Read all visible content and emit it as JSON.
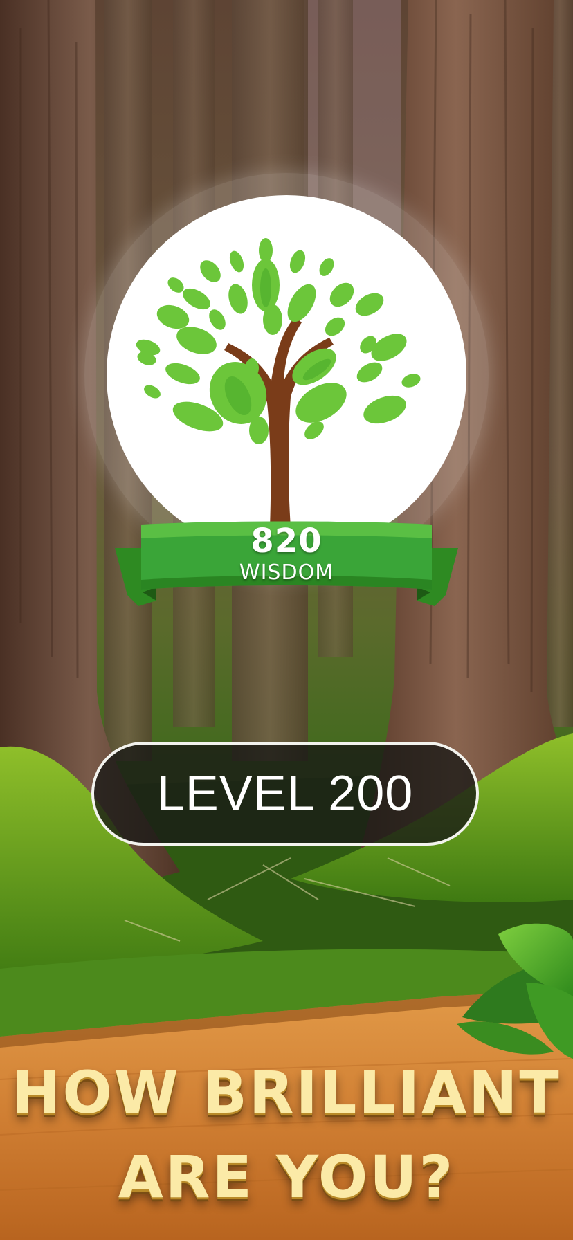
{
  "badge": {
    "value": "820",
    "label": "WISDOM",
    "icon": "tree-icon"
  },
  "level": {
    "label": "LEVEL 200"
  },
  "headline": {
    "line1": "HOW BRILLIANT",
    "line2": "ARE YOU?"
  },
  "colors": {
    "ribbon_green": "#3aa538",
    "leaf_green": "#6cc63a",
    "trunk_brown": "#7a3c19",
    "wood_orange": "#d98a3a",
    "headline_gold": "#fbeaa7"
  }
}
